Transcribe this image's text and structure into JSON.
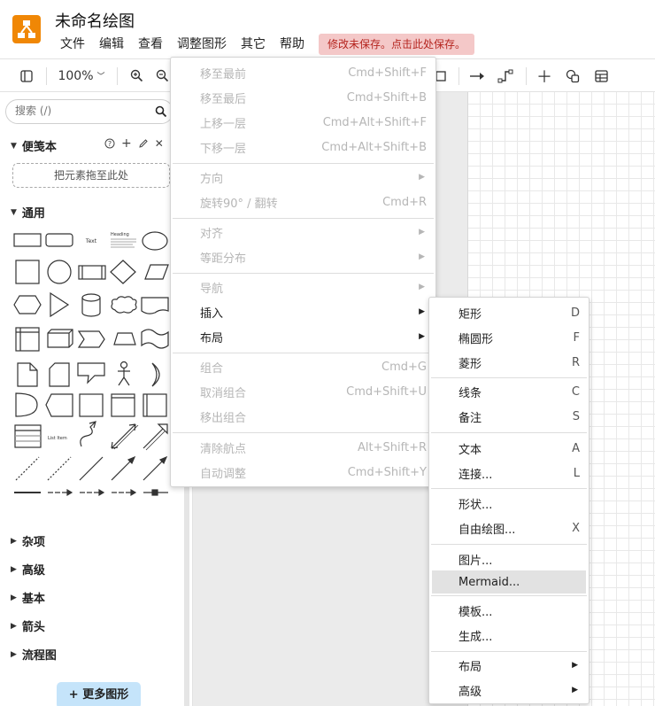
{
  "app": {
    "title": "未命名绘图",
    "menus": [
      "文件",
      "编辑",
      "查看",
      "调整图形",
      "其它",
      "帮助"
    ],
    "save_warning": "修改未保存。点击此处保存。"
  },
  "toolbar": {
    "zoom": "100%"
  },
  "sidebar": {
    "search_placeholder": "搜索 (/)",
    "scratchpad_title": "便笺本",
    "scratchpad_drop": "把元素拖至此处",
    "general_title": "通用",
    "shape_text": "Text",
    "shape_heading": "Heading",
    "shape_list_item": "List Item",
    "sections": [
      "杂项",
      "高级",
      "基本",
      "箭头",
      "流程图"
    ],
    "more_shapes": "+ 更多图形"
  },
  "arrange_menu": {
    "items": [
      {
        "label": "移至最前",
        "shortcut": "Cmd+Shift+F",
        "enabled": false
      },
      {
        "label": "移至最后",
        "shortcut": "Cmd+Shift+B",
        "enabled": false
      },
      {
        "label": "上移一层",
        "shortcut": "Cmd+Alt+Shift+F",
        "enabled": false
      },
      {
        "label": "下移一层",
        "shortcut": "Cmd+Alt+Shift+B",
        "enabled": false
      },
      {
        "label": "方向",
        "shortcut": "",
        "enabled": false,
        "submenu": true
      },
      {
        "label": "旋转90° / 翻转",
        "shortcut": "Cmd+R",
        "enabled": false
      },
      {
        "label": "对齐",
        "shortcut": "",
        "enabled": false,
        "submenu": true
      },
      {
        "label": "等距分布",
        "shortcut": "",
        "enabled": false,
        "submenu": true
      },
      {
        "label": "导航",
        "shortcut": "",
        "enabled": false,
        "submenu": true
      },
      {
        "label": "插入",
        "shortcut": "",
        "enabled": true,
        "submenu": true
      },
      {
        "label": "布局",
        "shortcut": "",
        "enabled": true,
        "submenu": true
      },
      {
        "label": "组合",
        "shortcut": "Cmd+G",
        "enabled": false
      },
      {
        "label": "取消组合",
        "shortcut": "Cmd+Shift+U",
        "enabled": false
      },
      {
        "label": "移出组合",
        "shortcut": "",
        "enabled": false
      },
      {
        "label": "清除航点",
        "shortcut": "Alt+Shift+R",
        "enabled": false
      },
      {
        "label": "自动调整",
        "shortcut": "Cmd+Shift+Y",
        "enabled": false
      }
    ]
  },
  "insert_menu": {
    "items": [
      {
        "label": "矩形",
        "shortcut": "D"
      },
      {
        "label": "椭圆形",
        "shortcut": "F"
      },
      {
        "label": "菱形",
        "shortcut": "R"
      },
      {
        "label": "线条",
        "shortcut": "C"
      },
      {
        "label": "备注",
        "shortcut": "S"
      },
      {
        "label": "文本",
        "shortcut": "A"
      },
      {
        "label": "连接...",
        "shortcut": "L"
      },
      {
        "label": "形状...",
        "shortcut": ""
      },
      {
        "label": "自由绘图...",
        "shortcut": "X"
      },
      {
        "label": "图片...",
        "shortcut": ""
      },
      {
        "label": "Mermaid...",
        "shortcut": "",
        "highlighted": true
      },
      {
        "label": "模板...",
        "shortcut": ""
      },
      {
        "label": "生成...",
        "shortcut": ""
      },
      {
        "label": "布局",
        "shortcut": "",
        "submenu": true
      },
      {
        "label": "高级",
        "shortcut": "",
        "submenu": true
      }
    ]
  }
}
